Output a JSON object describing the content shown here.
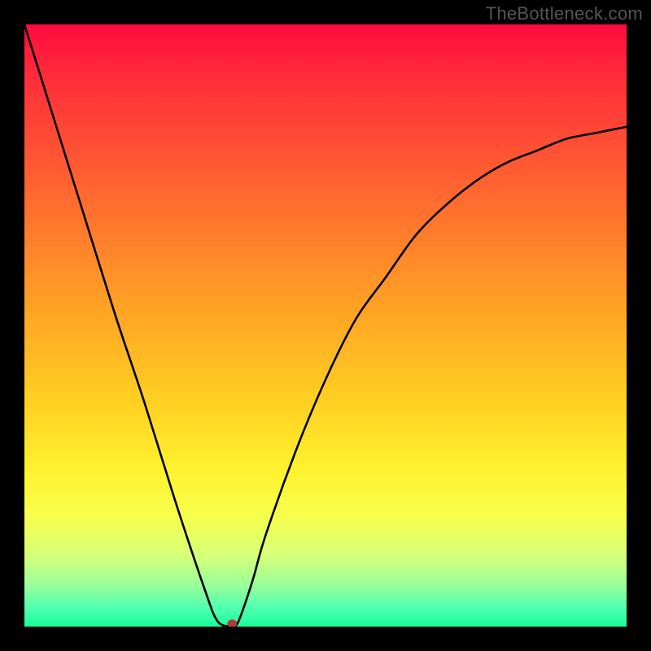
{
  "watermark": "TheBottleneck.com",
  "chart_data": {
    "type": "line",
    "title": "",
    "xlabel": "",
    "ylabel": "",
    "xlim": [
      0,
      100
    ],
    "ylim": [
      0,
      100
    ],
    "series": [
      {
        "name": "bottleneck-curve",
        "x": [
          0,
          5,
          10,
          15,
          20,
          25,
          30,
          32,
          34,
          35,
          36,
          38,
          40,
          45,
          50,
          55,
          60,
          65,
          70,
          75,
          80,
          85,
          90,
          95,
          100
        ],
        "y": [
          100,
          84,
          68,
          52,
          37,
          21,
          6,
          1,
          0,
          0,
          2,
          8,
          15,
          29,
          41,
          51,
          58,
          65,
          70,
          74,
          77,
          79,
          81,
          82,
          83
        ]
      }
    ],
    "marker": {
      "x": 34.5,
      "y": 0.5,
      "color": "#b03a3a"
    },
    "background_gradient": {
      "top": "#ff0a3f",
      "bottom": "#18ff9a"
    }
  }
}
